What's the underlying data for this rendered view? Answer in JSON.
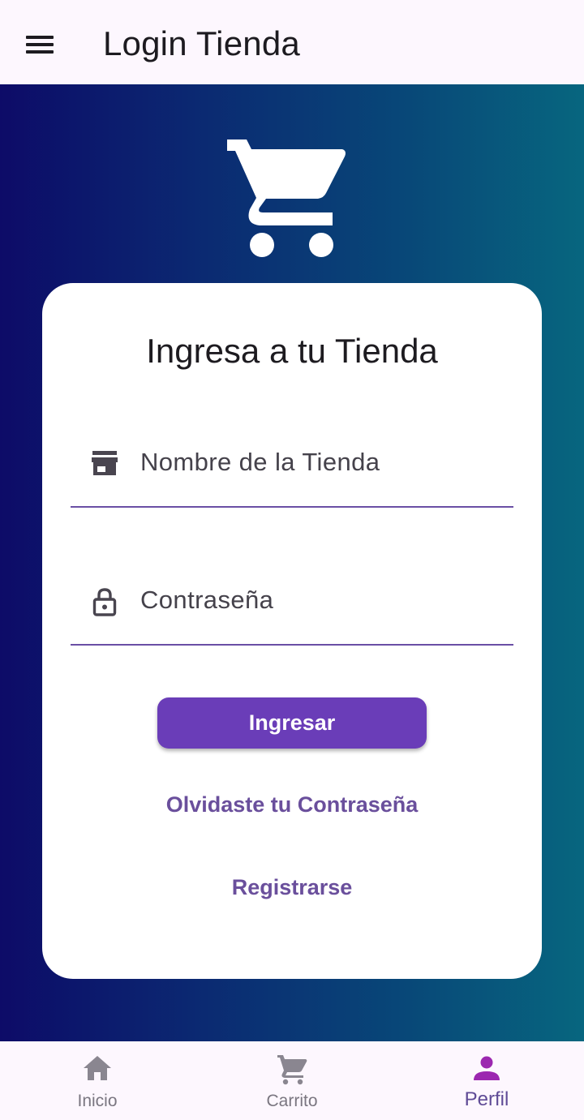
{
  "appbar": {
    "title": "Login Tienda",
    "menu_icon": "hamburger-menu-icon"
  },
  "hero": {
    "logo_icon": "shopping-cart-icon",
    "gradient": [
      "#0d0b68",
      "#07667f"
    ]
  },
  "card": {
    "title": "Ingresa a tu Tienda",
    "store_field": {
      "icon": "storefront-icon",
      "placeholder": "Nombre de la Tienda",
      "value": ""
    },
    "password_field": {
      "icon": "lock-icon",
      "placeholder": "Contraseña",
      "value": ""
    },
    "login_button": "Ingresar",
    "forgot_link": "Olvidaste tu Contraseña",
    "register_link": "Registrarse"
  },
  "bottom_nav": {
    "items": [
      {
        "label": "Inicio",
        "icon": "home-icon",
        "active": false
      },
      {
        "label": "Carrito",
        "icon": "cart-icon",
        "active": false
      },
      {
        "label": "Perfil",
        "icon": "person-icon",
        "active": true
      }
    ]
  },
  "colors": {
    "accent": "#6a3db8",
    "link": "#6a4f9c",
    "active_nav": "#9c27b0",
    "inactive_nav": "#8a8690"
  }
}
